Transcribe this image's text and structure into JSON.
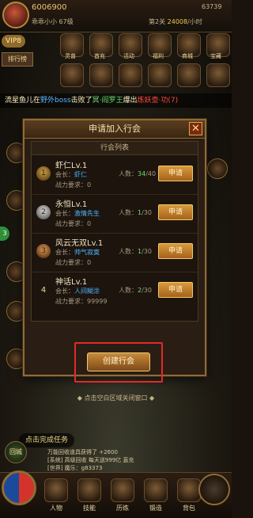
{
  "top": {
    "gold": "6006900",
    "player_name": "乖乖小小 67级",
    "level_text": "第2关",
    "rate": "24008",
    "rate_unit": "/小时",
    "gems": "63739",
    "vip": "VIP8",
    "left_button": "排行榜"
  },
  "icons": [
    {
      "name": "pet-icon",
      "label": "灵兽"
    },
    {
      "name": "recharge-icon",
      "label": "首充"
    },
    {
      "name": "event-icon",
      "label": "活动"
    },
    {
      "name": "welfare-icon",
      "label": "福利"
    },
    {
      "name": "shop-icon",
      "label": "商城"
    },
    {
      "name": "treasure-icon",
      "label": "宝藏"
    }
  ],
  "marquee": {
    "name": "流星鱼儿",
    "t1": "在",
    "place": "野外boss",
    "t2": "击败了",
    "boss": "冥·阎罗王",
    "t3": "爆出",
    "item": "炼妖壶·功(7)"
  },
  "dialog": {
    "title": "申请加入行会",
    "close": "✕",
    "list_header": "行会列表",
    "leader_label": "会长：",
    "power_label": "战力要求：",
    "members_label": "人数：",
    "apply_label": "申请",
    "create_button": "创建行会",
    "guilds": [
      {
        "rank": "1",
        "name": "虾仁Lv.1",
        "leader": "虾仁",
        "power": "0",
        "current": "34",
        "max": "/40"
      },
      {
        "rank": "2",
        "name": "永恒Lv.1",
        "leader": "激情先生",
        "power": "0",
        "current": "1",
        "max": "/30"
      },
      {
        "rank": "3",
        "name": "风云无双Lv.1",
        "leader": "帅气寂寞",
        "power": "0",
        "current": "1",
        "max": "/30"
      },
      {
        "rank": "4",
        "name": "神话Lv.1",
        "leader": "人间糊涂",
        "power": "99999",
        "current": "2",
        "max": "/30"
      }
    ]
  },
  "hint": "◆ 点击空白区域关闭窗口 ◆",
  "bottom": {
    "task": "点击完成任务",
    "huicheng": "回城",
    "chat_lines": [
      "万能回收道具获得了 +2600",
      "[系统] 高级回收 每天送999亿 直充",
      "[世界] 魔乐：g83373"
    ],
    "nav": [
      "人物",
      "技能",
      "历练",
      "锻造",
      "背包"
    ]
  }
}
